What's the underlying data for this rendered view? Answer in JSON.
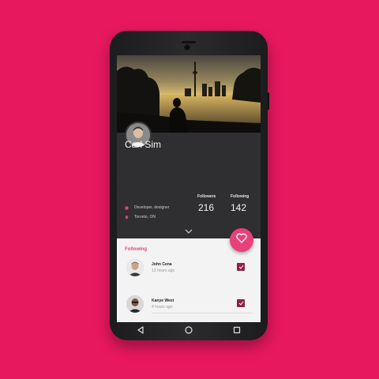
{
  "profile": {
    "name": "Carl Sim",
    "occupation": "Developer, designer",
    "location": "Toronto, ON",
    "followers_label": "Followers",
    "followers_value": "216",
    "following_label": "Following",
    "following_value": "142"
  },
  "following_section": {
    "title": "Following",
    "items": [
      {
        "name": "John Cena",
        "time": "13 hours ago",
        "checked": true
      },
      {
        "name": "Kanye West",
        "time": "4 hours ago",
        "checked": true
      }
    ]
  },
  "icons": {
    "occupation": "briefcase-icon",
    "location": "location-pin-icon",
    "expand": "chevron-down-icon",
    "favorite": "heart-icon",
    "nav_back": "triangle-back-icon",
    "nav_home": "circle-home-icon",
    "nav_recents": "square-recents-icon"
  },
  "colors": {
    "background": "#e8185f",
    "accent": "#e8407a",
    "checkbox": "#8e1f47"
  }
}
